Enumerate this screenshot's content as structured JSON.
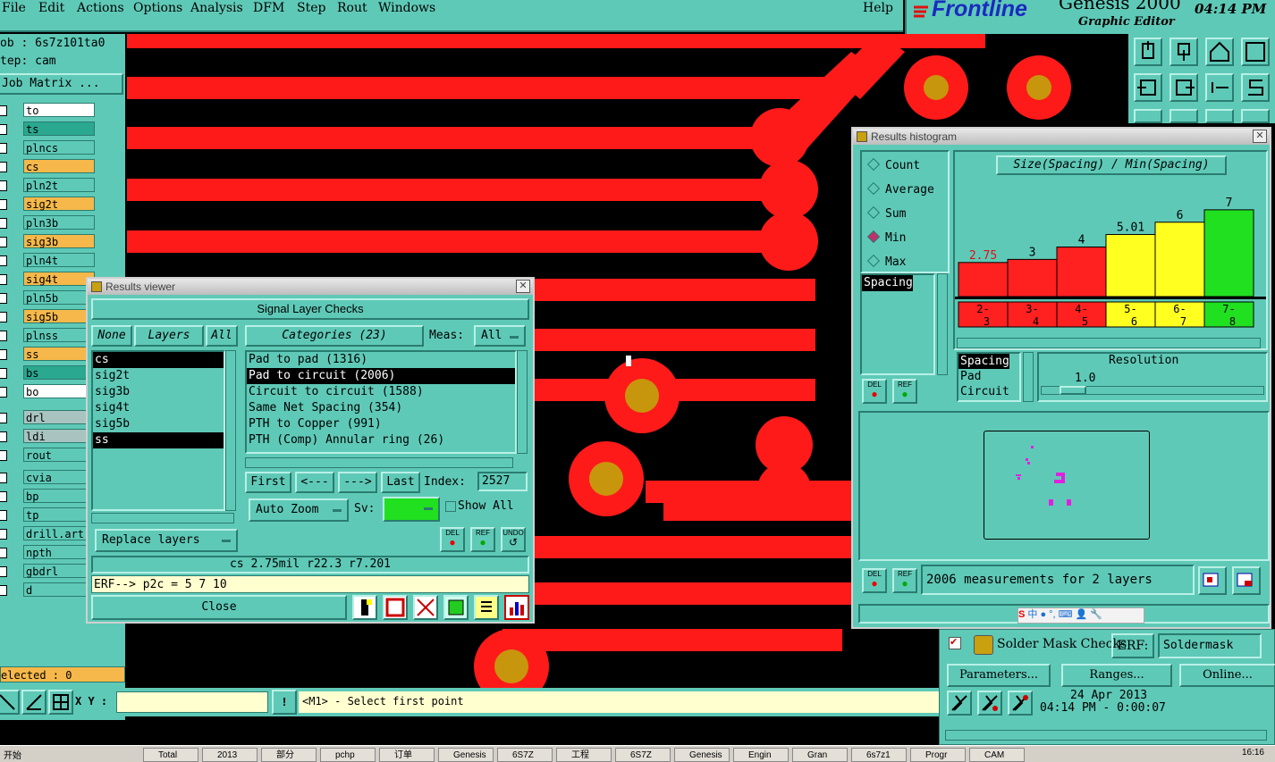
{
  "menu": {
    "items": [
      "File",
      "Edit",
      "Actions",
      "Options",
      "Analysis",
      "DFM",
      "Step",
      "Rout",
      "Windows"
    ],
    "help": "Help"
  },
  "brand": {
    "logo": "Frontline",
    "product": "Genesis 2000",
    "subtitle": "Graphic Editor",
    "time": "04:14 PM"
  },
  "job": {
    "job_label": "ob  : 6s7z101ta0",
    "step_label": "tep: cam",
    "matrix_button": "Job Matrix ..."
  },
  "layers": [
    {
      "name": "to",
      "color": "#ffffff"
    },
    {
      "name": "ts",
      "color": "#2aa890"
    },
    {
      "name": "plncs",
      "color": "#5fc9b7"
    },
    {
      "name": "cs",
      "color": "#f6b84a"
    },
    {
      "name": "pln2t",
      "color": "#5fc9b7"
    },
    {
      "name": "sig2t",
      "color": "#f6b84a"
    },
    {
      "name": "pln3b",
      "color": "#5fc9b7"
    },
    {
      "name": "sig3b",
      "color": "#f6b84a"
    },
    {
      "name": "pln4t",
      "color": "#5fc9b7"
    },
    {
      "name": "sig4t",
      "color": "#f6b84a"
    },
    {
      "name": "pln5b",
      "color": "#5fc9b7"
    },
    {
      "name": "sig5b",
      "color": "#f6b84a"
    },
    {
      "name": "plnss",
      "color": "#5fc9b7"
    },
    {
      "name": "ss",
      "color": "#f6b84a"
    },
    {
      "name": "bs",
      "color": "#2aa890"
    },
    {
      "name": "bo",
      "color": "#ffffff"
    },
    {
      "name": "drl",
      "color": "#a9c4c0"
    },
    {
      "name": "ldi",
      "color": "#a9c4c0"
    },
    {
      "name": "rout",
      "color": "#5fc9b7"
    },
    {
      "name": "cvia",
      "color": "#5fc9b7"
    },
    {
      "name": "bp",
      "color": "#5fc9b7"
    },
    {
      "name": "tp",
      "color": "#5fc9b7"
    },
    {
      "name": "drill.art",
      "color": "#5fc9b7"
    },
    {
      "name": "npth",
      "color": "#5fc9b7"
    },
    {
      "name": "gbdrl",
      "color": "#5fc9b7"
    },
    {
      "name": "d",
      "color": "#5fc9b7"
    }
  ],
  "selected_label": "elected : 0",
  "status": {
    "xy_label": "X Y :",
    "prompt": "<M1> - Select first point"
  },
  "results_viewer": {
    "title": "Results viewer",
    "header": "Signal Layer Checks",
    "none_btn": "None",
    "layers_btn": "Layers",
    "all_btn": "All",
    "layer_list": [
      "cs",
      "sig2t",
      "sig3b",
      "sig4t",
      "sig5b",
      "ss"
    ],
    "categories_btn": "Categories (23)",
    "meas_label": "Meas:",
    "meas_value": "All",
    "categories": [
      "Pad to pad (1316)",
      "Pad to circuit (2006)",
      "Circuit to circuit (1588)",
      "Same Net Spacing (354)",
      "PTH to Copper (991)",
      "PTH (Comp) Annular ring (26)"
    ],
    "first_btn": "First",
    "prev_btn": "<---",
    "next_btn": "--->",
    "last_btn": "Last",
    "index_label": "Index:",
    "index_value": "2527",
    "zoom_value": "Auto Zoom",
    "sv_label": "Sv:",
    "show_all": "Show All",
    "replace_layers": "Replace layers",
    "del_label": "DEL",
    "ref_label": "REF",
    "undo_label": "UNDO",
    "info_line": "cs 2.75mil   r22.3   r7.201",
    "erf_line": "ERF--> p2c = 5 7 10",
    "close_btn": "Close"
  },
  "histogram": {
    "title": "Results histogram",
    "modes": [
      {
        "label": "Count",
        "on": false
      },
      {
        "label": "Average",
        "on": false
      },
      {
        "label": "Sum",
        "on": false
      },
      {
        "label": "Min",
        "on": true
      },
      {
        "label": "Max",
        "on": false
      }
    ],
    "measure_list": [
      "Spacing"
    ],
    "chart_title": "Size(Spacing) / Min(Spacing)",
    "resolution_label": "Resolution",
    "resolution_value": "1.0",
    "type_list": [
      "Spacing",
      "Pad",
      "Circuit"
    ],
    "footer": "2006 measurements for 2 layers",
    "del_label": "DEL",
    "ref_label": "REF"
  },
  "chart_data": {
    "type": "bar",
    "categories": [
      "2-\n3",
      "3-\n4",
      "4-\n5",
      "5-\n6",
      "6-\n7",
      "7-\n8"
    ],
    "category_labels_top": [
      "2-",
      "3-",
      "4-",
      "5-",
      "6-",
      "7-"
    ],
    "category_labels_bottom": [
      "3",
      "4",
      "5",
      "6",
      "7",
      "8"
    ],
    "values": [
      2.75,
      3,
      4,
      5.01,
      6,
      7
    ],
    "value_labels": [
      "2.75",
      "3",
      "4",
      "5.01",
      "6",
      "7"
    ],
    "colors": [
      "#ff2020",
      "#ff2020",
      "#ff2020",
      "#ffff20",
      "#ffff20",
      "#20e020"
    ],
    "label_colors": [
      "#e01010",
      "#000000",
      "#000000",
      "#000000",
      "#000000",
      "#000000"
    ],
    "ylim": [
      0,
      8
    ]
  },
  "solder": {
    "title": "Solder Mask Checks",
    "erf_label": "ERF:",
    "erf_value": "Soldermask",
    "params_btn": "Parameters...",
    "ranges_btn": "Ranges...",
    "online_btn": "Online...",
    "date": "24 Apr 2013",
    "time": "04:14 PM - 0:00:07"
  },
  "taskbar": {
    "start": "开始",
    "tasks": [
      "Total",
      "2013",
      "部分",
      "pchp",
      "订单",
      "Genesis",
      "6S7Z",
      "工程",
      "6S7Z",
      "Genesis",
      "Engin",
      "Gran",
      "6s7z1",
      "Progr",
      "CAM"
    ],
    "clock": "16:16"
  },
  "colors": {
    "panel": "#5fc9b7",
    "copper": "#ff1a1a",
    "drill": "#c8960c"
  }
}
